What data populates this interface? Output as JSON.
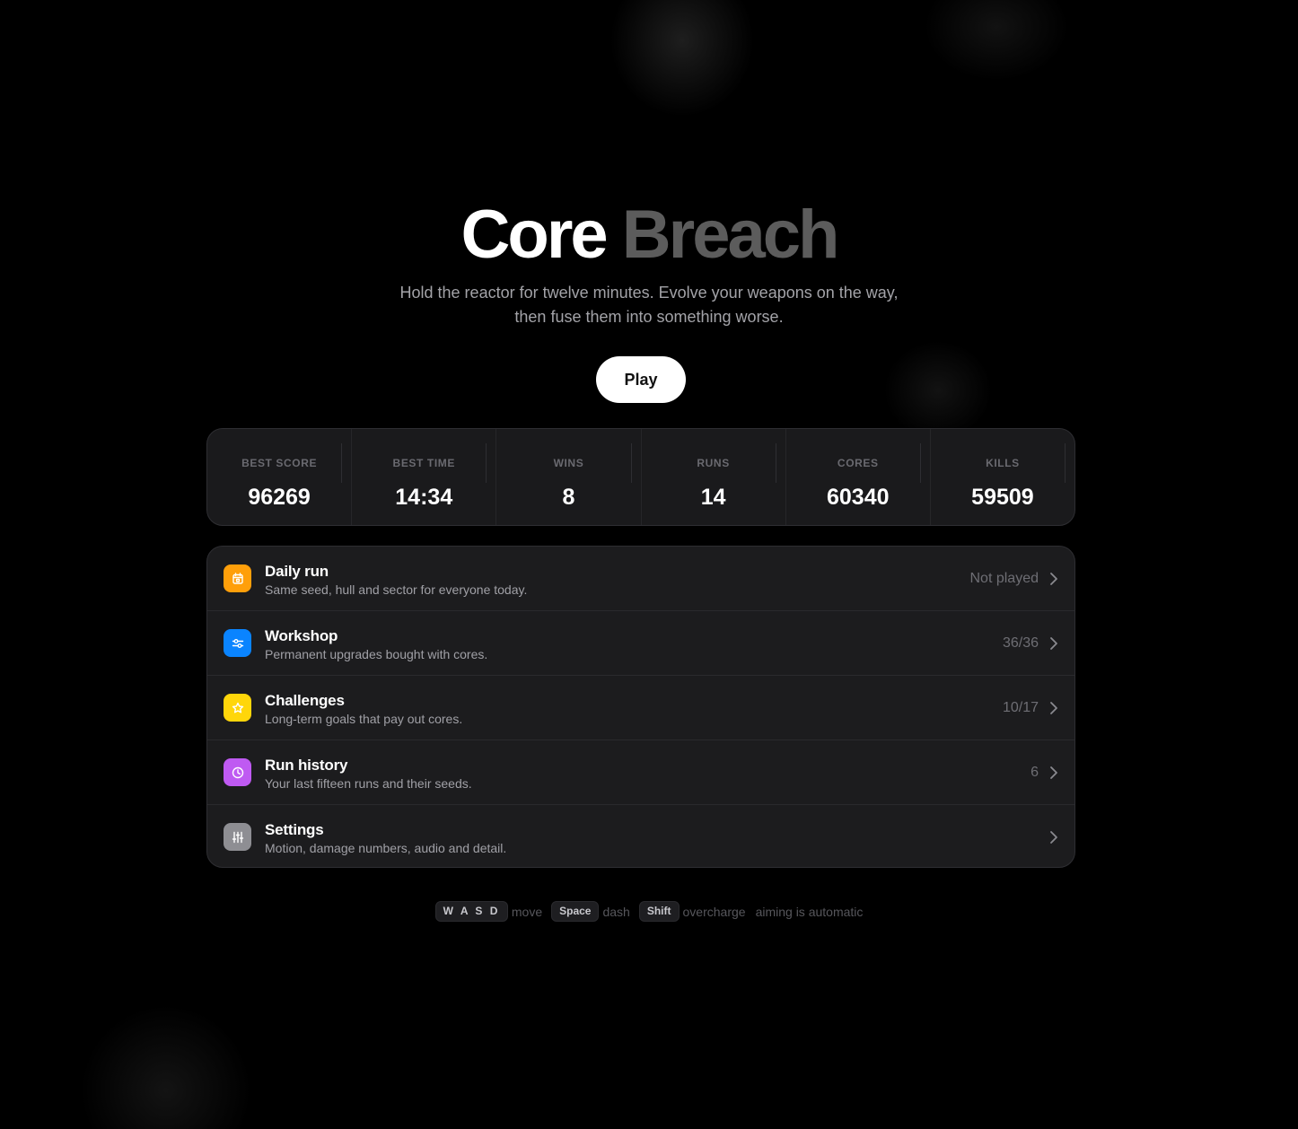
{
  "title": {
    "word1": "Core",
    "word2": "Breach"
  },
  "tagline": {
    "line1": "Hold the reactor for twelve minutes. Evolve your weapons on the way,",
    "line2": "then fuse them into something worse."
  },
  "play_label": "Play",
  "stats": [
    {
      "label": "BEST SCORE",
      "value": "96269"
    },
    {
      "label": "BEST TIME",
      "value": "14:34"
    },
    {
      "label": "WINS",
      "value": "8"
    },
    {
      "label": "RUNS",
      "value": "14"
    },
    {
      "label": "CORES",
      "value": "60340"
    },
    {
      "label": "KILLS",
      "value": "59509"
    }
  ],
  "menu": [
    {
      "title": "Daily run",
      "subtitle": "Same seed, hull and sector for everyone today.",
      "status": "Not played",
      "icon": "calendar-icon",
      "color": "#ff9f0a"
    },
    {
      "title": "Workshop",
      "subtitle": "Permanent upgrades bought with cores.",
      "status": "36/36",
      "icon": "sliders-icon",
      "color": "#0a84ff"
    },
    {
      "title": "Challenges",
      "subtitle": "Long-term goals that pay out cores.",
      "status": "10/17",
      "icon": "star-icon",
      "color": "#ffd60a"
    },
    {
      "title": "Run history",
      "subtitle": "Your last fifteen runs and their seeds.",
      "status": "6",
      "icon": "clock-icon",
      "color": "#bf5af2"
    },
    {
      "title": "Settings",
      "subtitle": "Motion, damage numbers, audio and detail.",
      "status": "",
      "icon": "tune-icon",
      "color": "#8e8e93"
    }
  ],
  "controls": {
    "key1": "W A S D",
    "text1": "move",
    "key2": "Space",
    "text2": "dash",
    "key3": "Shift",
    "text3": "overcharge",
    "note": "aiming is automatic"
  }
}
